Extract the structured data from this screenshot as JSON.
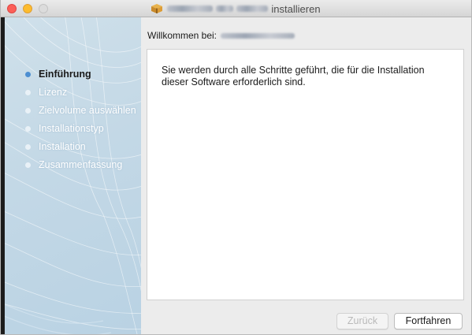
{
  "window": {
    "title_suffix": "installieren",
    "title_prefix": "‹",
    "title_quote": "”"
  },
  "sidebar": {
    "items": [
      {
        "label": "Einführung",
        "active": true
      },
      {
        "label": "Lizenz",
        "active": false
      },
      {
        "label": "Zielvolume auswählen",
        "active": false
      },
      {
        "label": "Installationstyp",
        "active": false
      },
      {
        "label": "Installation",
        "active": false
      },
      {
        "label": "Zusammenfassung",
        "active": false
      }
    ]
  },
  "main": {
    "heading_label": "Willkommen bei:",
    "body_text": "Sie werden durch alle Schritte geführt, die für die Installation dieser Software erforderlich sind."
  },
  "buttons": {
    "back_label": "Zurück",
    "continue_label": "Fortfahren"
  },
  "colors": {
    "close": "#fc5f57",
    "minimize": "#fdbc2e",
    "zoom": "#dcdcdc",
    "active_step_dot": "#4d8fd1"
  },
  "icons": {
    "title": "package-icon"
  }
}
